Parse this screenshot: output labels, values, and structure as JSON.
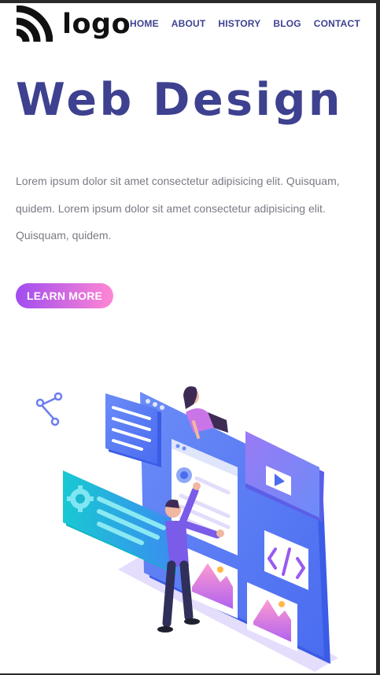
{
  "header": {
    "logo_text": "logo",
    "nav": [
      "HOME",
      "ABOUT",
      "HISTORY",
      "BLOG",
      "CONTACT"
    ]
  },
  "hero": {
    "title": "Web Design",
    "body": "Lorem ipsum dolor sit amet consectetur adipisicing elit. Quisquam, quidem. Lorem ipsum dolor sit amet consectetur adipisicing elit. Quisquam, quidem.",
    "cta_label": "LEARN MORE"
  },
  "icons": {
    "logo": "wifi-arcs-icon",
    "share": "share-icon",
    "settings": "gear-icon",
    "code": "code-icon",
    "image": "image-icon",
    "play": "play-icon"
  },
  "colors": {
    "title": "#3d418f",
    "nav": "#3d4291",
    "body_text": "#7a7a85",
    "button_from": "#a14cf0",
    "button_to": "#ff87d3",
    "illustration_blue": "#4f7cf4",
    "illustration_teal": "#1dd6c8",
    "illustration_purple": "#8b63f2"
  }
}
